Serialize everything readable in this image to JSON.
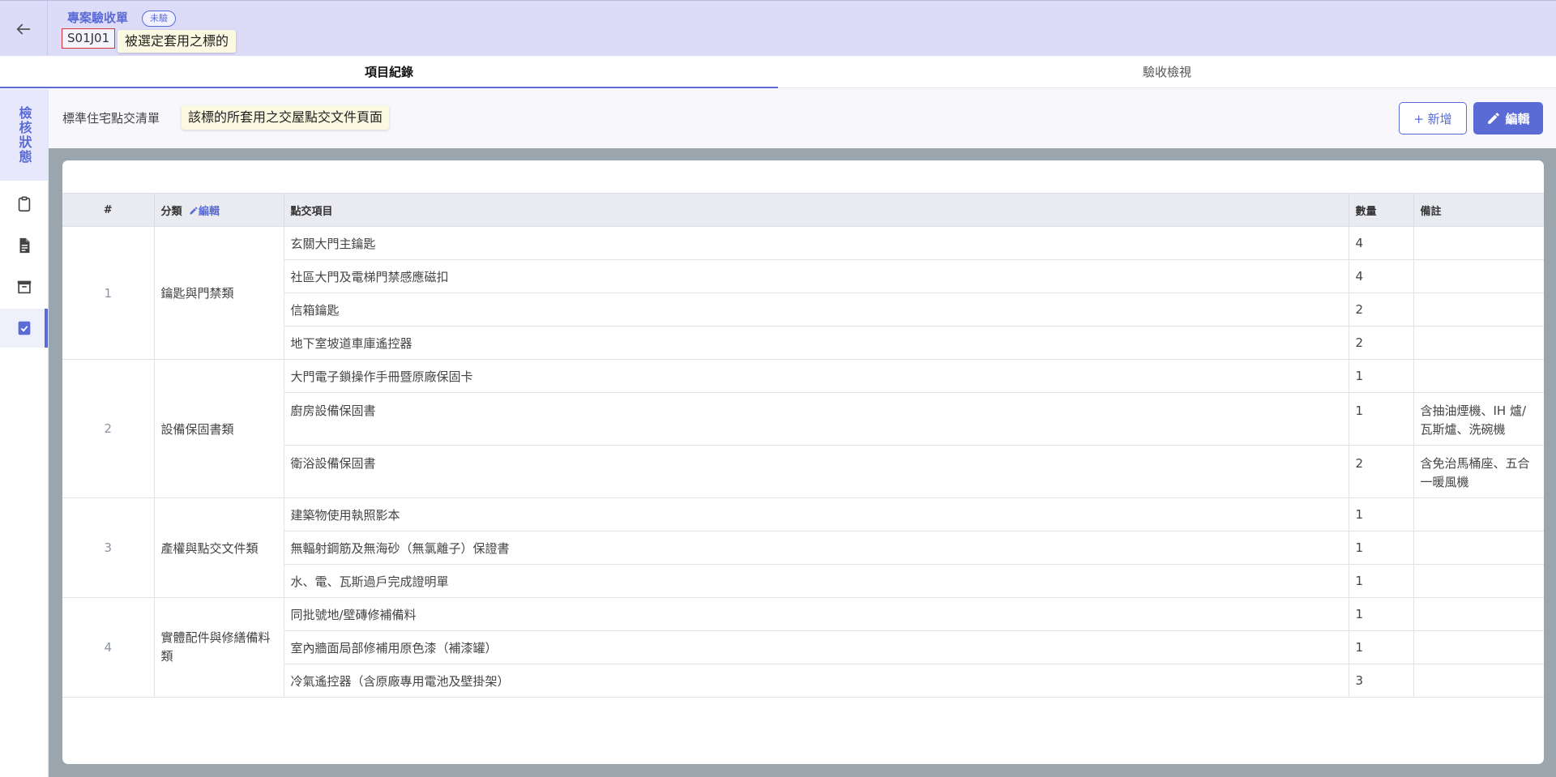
{
  "header": {
    "title": "專案驗收單",
    "status": "未驗",
    "code": "S01J01",
    "tooltip_target": "被選定套用之標的"
  },
  "tabs": [
    {
      "label": "項目紀錄",
      "active": true
    },
    {
      "label": "驗收檢視",
      "active": false
    }
  ],
  "sidebar": {
    "status_label": "檢核狀態",
    "items": [
      {
        "icon": "clipboard-icon",
        "active": false
      },
      {
        "icon": "document-icon",
        "active": false
      },
      {
        "icon": "archive-icon",
        "active": false
      },
      {
        "icon": "clipboard-check-icon",
        "active": true
      }
    ]
  },
  "content": {
    "list_title": "標準住宅點交清單",
    "tooltip_page": "該標的所套用之交屋點交文件頁面",
    "add_label": "+ 新增",
    "edit_label": "編輯"
  },
  "table": {
    "headers": {
      "index": "#",
      "category": "分類",
      "category_edit": "編輯",
      "item": "點交項目",
      "qty": "數量",
      "note": "備註"
    },
    "groups": [
      {
        "index": "1",
        "category": "鑰匙與門禁類",
        "rows": [
          {
            "item": "玄關大門主鑰匙",
            "qty": "4",
            "note": ""
          },
          {
            "item": "社區大門及電梯門禁感應磁扣",
            "qty": "4",
            "note": ""
          },
          {
            "item": "信箱鑰匙",
            "qty": "2",
            "note": ""
          },
          {
            "item": "地下室坡道車庫遙控器",
            "qty": "2",
            "note": ""
          }
        ]
      },
      {
        "index": "2",
        "category": "設備保固書類",
        "rows": [
          {
            "item": "大門電子鎖操作手冊暨原廠保固卡",
            "qty": "1",
            "note": ""
          },
          {
            "item": "廚房設備保固書",
            "qty": "1",
            "note": "含抽油煙機、IH 爐/瓦斯爐、洗碗機"
          },
          {
            "item": "衛浴設備保固書",
            "qty": "2",
            "note": "含免治馬桶座、五合一暖風機"
          }
        ]
      },
      {
        "index": "3",
        "category": "產權與點交文件類",
        "rows": [
          {
            "item": "建築物使用執照影本",
            "qty": "1",
            "note": ""
          },
          {
            "item": "無輻射鋼筋及無海砂（無氯離子）保證書",
            "qty": "1",
            "note": ""
          },
          {
            "item": "水、電、瓦斯過戶完成證明單",
            "qty": "1",
            "note": ""
          }
        ]
      },
      {
        "index": "4",
        "category": "實體配件與修繕備料類",
        "rows": [
          {
            "item": "同批號地/壁磚修補備料",
            "qty": "1",
            "note": ""
          },
          {
            "item": "室內牆面局部修補用原色漆（補漆罐）",
            "qty": "1",
            "note": ""
          },
          {
            "item": "冷氣遙控器（含原廠專用電池及壁掛架）",
            "qty": "3",
            "note": ""
          }
        ]
      }
    ]
  }
}
